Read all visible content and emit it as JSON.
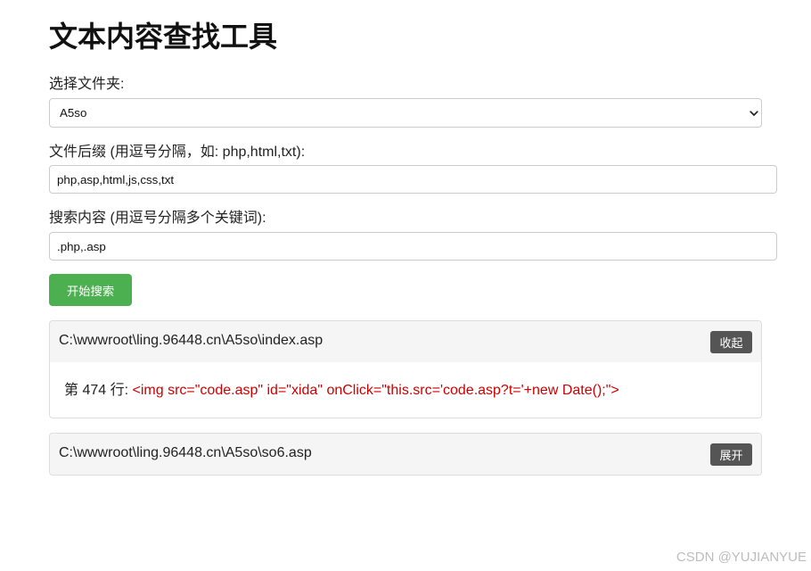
{
  "app": {
    "title": "文本内容查找工具"
  },
  "form": {
    "folder": {
      "label": "选择文件夹:",
      "selected": "A5so"
    },
    "extensions": {
      "label": "文件后缀 (用逗号分隔，如: php,html,txt):",
      "value": "php,asp,html,js,css,txt"
    },
    "keywords": {
      "label": "搜索内容 (用逗号分隔多个关键词):",
      "value": ".php,.asp"
    },
    "search_button": "开始搜索"
  },
  "results": [
    {
      "path": "C:\\wwwroot\\ling.96448.cn\\A5so\\index.asp",
      "toggle_label": "收起",
      "matches": [
        {
          "line_label": "第 474 行:",
          "code": "<img src=\"code.asp\" id=\"xida\" onClick=\"this.src='code.asp?t='+new Date();\">"
        }
      ]
    },
    {
      "path": "C:\\wwwroot\\ling.96448.cn\\A5so\\so6.asp",
      "toggle_label": "展开"
    }
  ],
  "watermark": "CSDN @YUJIANYUE",
  "icons": {
    "folder_select": "chevron-down-icon"
  },
  "colors": {
    "search_button": "#4CAF50",
    "toggle_button": "#555555",
    "match_code": "#cc0000",
    "result_header": "#f5f5f5"
  }
}
